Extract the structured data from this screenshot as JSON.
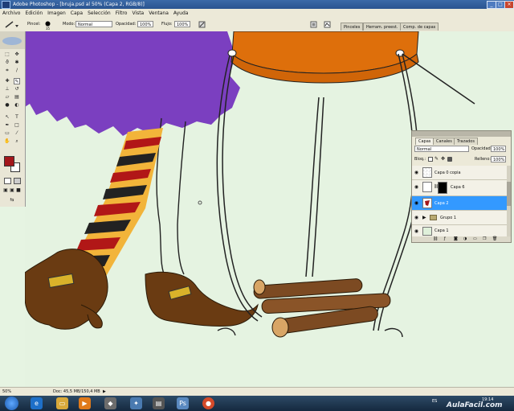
{
  "window": {
    "title": "Adobe Photoshop - [bruja.psd al 50% (Capa 2, RGB/8)]",
    "minimize": "_",
    "maximize": "□",
    "close": "×"
  },
  "menu": [
    "Archivo",
    "Edición",
    "Imagen",
    "Capa",
    "Selección",
    "Filtro",
    "Vista",
    "Ventana",
    "Ayuda"
  ],
  "options": {
    "brush_label": "Pincel:",
    "brush_size": "35",
    "mode_label": "Modo:",
    "mode_value": "Normal",
    "opacity_label": "Opacidad:",
    "opacity_value": "100%",
    "flow_label": "Flujo:",
    "flow_value": "100%",
    "panel_tabs": [
      "Pinceles",
      "Herram. preest.",
      "Comp. de capas"
    ]
  },
  "layers_panel": {
    "tabs": [
      "Capas",
      "Canales",
      "Trazados"
    ],
    "blend_mode": "Normal",
    "opacity_label": "Opacidad:",
    "opacity_value": "100%",
    "lock_label": "Bloq.:",
    "fill_label": "Relleno:",
    "fill_value": "100%",
    "layers": [
      {
        "name": "Capa 0 copia",
        "selected": false
      },
      {
        "name": "Capa 6",
        "selected": false
      },
      {
        "name": "Capa 2",
        "selected": true
      },
      {
        "name": "Grupo 1",
        "selected": false
      },
      {
        "name": "Capa 1",
        "selected": false
      }
    ]
  },
  "status": {
    "zoom": "50%",
    "doc": "Doc: 45,5 MB/150,4 MB"
  },
  "taskbar": {
    "language": "ES",
    "time": "19:14",
    "watermark": "AulaFacil.com"
  },
  "colors": {
    "foreground": "#a3161b",
    "background": "#ffffff",
    "selected_layer": "#3399ff",
    "hat": "#7b3fc0",
    "stool": "#de6f0b",
    "shoes": "#6a3b12",
    "wood": "#7c4a22"
  }
}
